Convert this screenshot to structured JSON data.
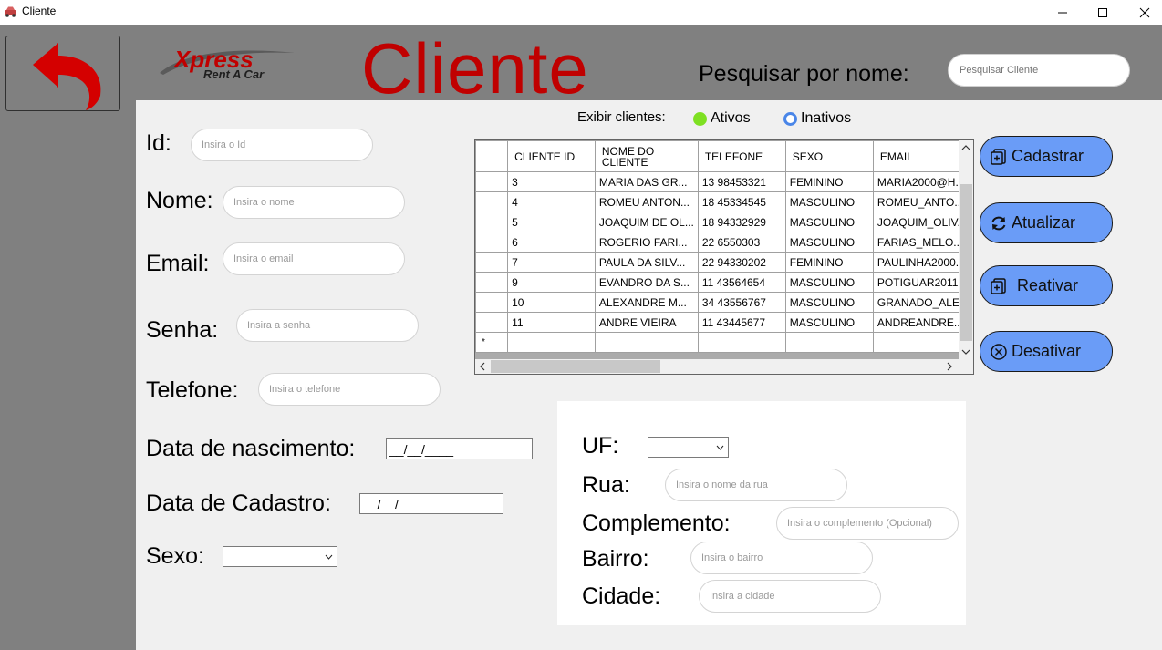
{
  "window": {
    "title": "Cliente",
    "icons": [
      "car-app-icon",
      "minimize-icon",
      "maximize-icon",
      "close-icon"
    ]
  },
  "header": {
    "back_icon": "back-arrow-icon",
    "logo_main": "Xpress",
    "logo_sub": "Rent A Car",
    "title": "Cliente",
    "search_label": "Pesquisar por nome:",
    "search_placeholder": "Pesquisar Cliente"
  },
  "form": {
    "id_label": "Id:",
    "id_placeholder": "Insira o Id",
    "nome_label": "Nome:",
    "nome_placeholder": "Insira o nome",
    "email_label": "Email:",
    "email_placeholder": "Insira o email",
    "senha_label": "Senha:",
    "senha_placeholder": "Insira a senha",
    "telefone_label": "Telefone:",
    "telefone_placeholder": "Insira o telefone",
    "nascimento_label": "Data de nascimento:",
    "nascimento_value": "__/__/____",
    "cadastro_label": "Data de Cadastro:",
    "cadastro_value": "__/__/____",
    "sexo_label": "Sexo:",
    "sexo_value": ""
  },
  "filter": {
    "label": "Exibir clientes:",
    "ativos": "Ativos",
    "inativos": "Inativos",
    "ativos_color": "#7ee022",
    "inativos_color": "#4a86e8"
  },
  "grid": {
    "columns": [
      "CLIENTE ID",
      "NOME DO CLIENTE",
      "TELEFONE",
      "SEXO",
      "EMAIL"
    ],
    "rows": [
      [
        "3",
        "MARIA DAS GR...",
        "13 98453321",
        "FEMININO",
        "MARIA2000@H..."
      ],
      [
        "4",
        "ROMEU ANTON...",
        "18 45334545",
        "MASCULINO",
        "ROMEU_ANTO..."
      ],
      [
        "5",
        "JOAQUIM DE OL...",
        "18 94332929",
        "MASCULINO",
        "JOAQUIM_OLIV..."
      ],
      [
        "6",
        "ROGERIO FARI...",
        "22 6550303",
        "MASCULINO",
        "FARIAS_MELO..."
      ],
      [
        "7",
        "PAULA DA SILV...",
        "22 94330202",
        "FEMININO",
        "PAULINHA2000..."
      ],
      [
        "9",
        "EVANDRO DA S...",
        "11 43564654",
        "MASCULINO",
        "POTIGUAR2011..."
      ],
      [
        "10",
        "ALEXANDRE M...",
        "34 43556767",
        "MASCULINO",
        "GRANADO_ALE..."
      ],
      [
        "11",
        "ANDRE VIEIRA",
        "11 43445677",
        "MASCULINO",
        "ANDREANDRE..."
      ]
    ],
    "new_row_marker": "*"
  },
  "actions": {
    "cadastrar": "Cadastrar",
    "atualizar": "Atualizar",
    "reativar": "Reativar",
    "desativar": "Desativar",
    "button_color": "#6a9cf7"
  },
  "address": {
    "uf_label": "UF:",
    "uf_value": "",
    "rua_label": "Rua:",
    "rua_placeholder": "Insira o nome da rua",
    "complemento_label": "Complemento:",
    "complemento_placeholder": "Insira o complemento (Opcional)",
    "bairro_label": "Bairro:",
    "bairro_placeholder": "Insira o bairro",
    "cidade_label": "Cidade:",
    "cidade_placeholder": "Insira a cidade"
  },
  "colors": {
    "title_red": "#c00000",
    "background_gray": "#808080",
    "panel_gray": "#f0f0f0"
  }
}
